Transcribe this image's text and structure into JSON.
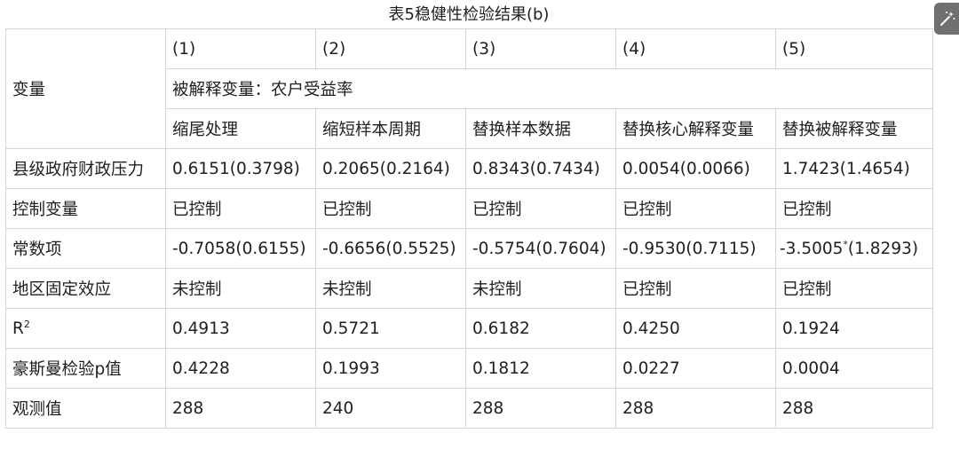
{
  "caption": "表5稳健性检验结果(b)",
  "table": {
    "var_header": "变量",
    "col_numbers": [
      "(1)",
      "(2)",
      "(3)",
      "(4)",
      "(5)"
    ],
    "dependent_var": "被解释变量：农户受益率",
    "methods": [
      "缩尾处理",
      "缩短样本周期",
      "替换样本数据",
      "替换核心解释变量",
      "替换被解释变量"
    ],
    "rows": [
      {
        "label": "县级政府财政压力",
        "cells": [
          "0.6151(0.3798)",
          "0.2065(0.2164)",
          "0.8343(0.7434)",
          "0.0054(0.0066)",
          "1.7423(1.4654)"
        ]
      },
      {
        "label": "控制变量",
        "cells": [
          "已控制",
          "已控制",
          "已控制",
          "已控制",
          "已控制"
        ]
      },
      {
        "label": "常数项",
        "cells": [
          "-0.7058(0.6155)",
          "-0.6656(0.5525)",
          "-0.5754(0.7604)",
          "-0.9530(0.7115)",
          "-3.5005"
        ],
        "last_sup": "*",
        "last_suffix": "(1.8293)"
      },
      {
        "label": "地区固定效应",
        "cells": [
          "未控制",
          "未控制",
          "未控制",
          "已控制",
          "已控制"
        ]
      },
      {
        "label_main": "R",
        "label_sup": "2",
        "cells": [
          "0.4913",
          "0.5721",
          "0.6182",
          "0.4250",
          "0.1924"
        ]
      },
      {
        "label": "豪斯曼检验p值",
        "cells": [
          "0.4228",
          "0.1993",
          "0.1812",
          "0.0227",
          "0.0004"
        ]
      },
      {
        "label": "观测值",
        "cells": [
          "288",
          "240",
          "288",
          "288",
          "288"
        ]
      }
    ]
  },
  "toolbar": {
    "icon": "magic-wand-icon"
  }
}
